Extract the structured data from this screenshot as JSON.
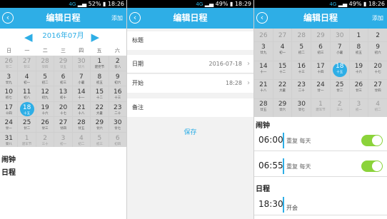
{
  "screen1": {
    "status": {
      "net": "4G",
      "battery": "52%",
      "time": "18:26"
    },
    "title": "编辑日程",
    "action": "添加",
    "month_label": "2016年07月",
    "weekdays": [
      "日",
      "一",
      "二",
      "三",
      "四",
      "五",
      "六"
    ],
    "days": [
      {
        "d": "26",
        "l": "廿二",
        "dim": true
      },
      {
        "d": "27",
        "l": "廿三",
        "dim": true
      },
      {
        "d": "28",
        "l": "廿四",
        "dim": true
      },
      {
        "d": "29",
        "l": "廿五",
        "dim": true
      },
      {
        "d": "30",
        "l": "廿六",
        "dim": true
      },
      {
        "d": "1",
        "l": "建党节"
      },
      {
        "d": "2",
        "l": "廿八"
      },
      {
        "d": "3",
        "l": "廿九"
      },
      {
        "d": "4",
        "l": "初一"
      },
      {
        "d": "5",
        "l": "初二"
      },
      {
        "d": "6",
        "l": "初三"
      },
      {
        "d": "7",
        "l": "小暑"
      },
      {
        "d": "8",
        "l": "初五"
      },
      {
        "d": "9",
        "l": "初六"
      },
      {
        "d": "10",
        "l": "初七"
      },
      {
        "d": "11",
        "l": "初八"
      },
      {
        "d": "12",
        "l": "初九"
      },
      {
        "d": "13",
        "l": "初十"
      },
      {
        "d": "14",
        "l": "十一"
      },
      {
        "d": "15",
        "l": "十二"
      },
      {
        "d": "16",
        "l": "十三"
      },
      {
        "d": "17",
        "l": "十四"
      },
      {
        "d": "18",
        "l": "十五",
        "sel": true
      },
      {
        "d": "19",
        "l": "十六"
      },
      {
        "d": "20",
        "l": "十七"
      },
      {
        "d": "21",
        "l": "十八"
      },
      {
        "d": "22",
        "l": "大暑"
      },
      {
        "d": "23",
        "l": "二十"
      },
      {
        "d": "24",
        "l": "廿一"
      },
      {
        "d": "25",
        "l": "廿二"
      },
      {
        "d": "26",
        "l": "廿三"
      },
      {
        "d": "27",
        "l": "廿四"
      },
      {
        "d": "28",
        "l": "廿五"
      },
      {
        "d": "29",
        "l": "廿六"
      },
      {
        "d": "30",
        "l": "廿七"
      },
      {
        "d": "31",
        "l": "廿八"
      },
      {
        "d": "1",
        "l": "建军节",
        "dim": true
      },
      {
        "d": "2",
        "l": "三十",
        "dim": true
      },
      {
        "d": "3",
        "l": "初一",
        "dim": true
      },
      {
        "d": "4",
        "l": "初二",
        "dim": true
      },
      {
        "d": "5",
        "l": "初三",
        "dim": true
      },
      {
        "d": "6",
        "l": "初四",
        "dim": true
      }
    ],
    "alarm_heading": "闹钟",
    "schedule_heading": "日程"
  },
  "screen2": {
    "status": {
      "net": "4G",
      "battery": "49%",
      "time": "18:29"
    },
    "title": "编辑日程",
    "title_field": "标题",
    "date_label": "日期",
    "date_value": "2016-07-18",
    "start_label": "开始",
    "start_value": "18:28",
    "note_label": "备注",
    "save": "保存"
  },
  "screen3": {
    "status": {
      "net": "4G",
      "battery": "49%",
      "time": "18:26"
    },
    "title": "编辑日程",
    "action": "添加",
    "partial_row": [
      "26",
      "27",
      "28",
      "29",
      "30",
      "1",
      "2"
    ],
    "days": [
      {
        "d": "3",
        "l": "廿九"
      },
      {
        "d": "4",
        "l": "初一"
      },
      {
        "d": "5",
        "l": "初二"
      },
      {
        "d": "6",
        "l": "初三"
      },
      {
        "d": "7",
        "l": "小暑"
      },
      {
        "d": "8",
        "l": "初五"
      },
      {
        "d": "9",
        "l": "初六"
      },
      {
        "d": "14",
        "l": "十一"
      },
      {
        "d": "15",
        "l": "十二"
      },
      {
        "d": "16",
        "l": "十三"
      },
      {
        "d": "17",
        "l": "十四"
      },
      {
        "d": "18",
        "l": "十五",
        "sel": true
      },
      {
        "d": "19",
        "l": "十六"
      },
      {
        "d": "20",
        "l": "十七"
      },
      {
        "d": "21",
        "l": "十八"
      },
      {
        "d": "22",
        "l": "大暑"
      },
      {
        "d": "23",
        "l": "二十"
      },
      {
        "d": "24",
        "l": "廿一"
      },
      {
        "d": "25",
        "l": "廿二"
      },
      {
        "d": "26",
        "l": "廿三"
      },
      {
        "d": "27",
        "l": "廿四"
      },
      {
        "d": "28",
        "l": "廿五"
      },
      {
        "d": "29",
        "l": "廿六"
      },
      {
        "d": "30",
        "l": "廿七"
      },
      {
        "d": "1",
        "l": "建军节",
        "dim": true
      },
      {
        "d": "2",
        "l": "三十",
        "dim": true
      },
      {
        "d": "3",
        "l": "初一",
        "dim": true
      },
      {
        "d": "4",
        "l": "初二",
        "dim": true
      }
    ],
    "alarm_heading": "闹钟",
    "alarms": [
      {
        "time": "06:00",
        "repeat": "重复  每天",
        "enabled": true
      },
      {
        "time": "06:55",
        "repeat": "重复  每天",
        "enabled": true
      }
    ],
    "schedule_heading": "日程",
    "events": [
      {
        "time": "18:30",
        "text": "开会"
      }
    ]
  },
  "colors": {
    "accent": "#2eaee6",
    "toggle_on": "#8bd33a"
  }
}
